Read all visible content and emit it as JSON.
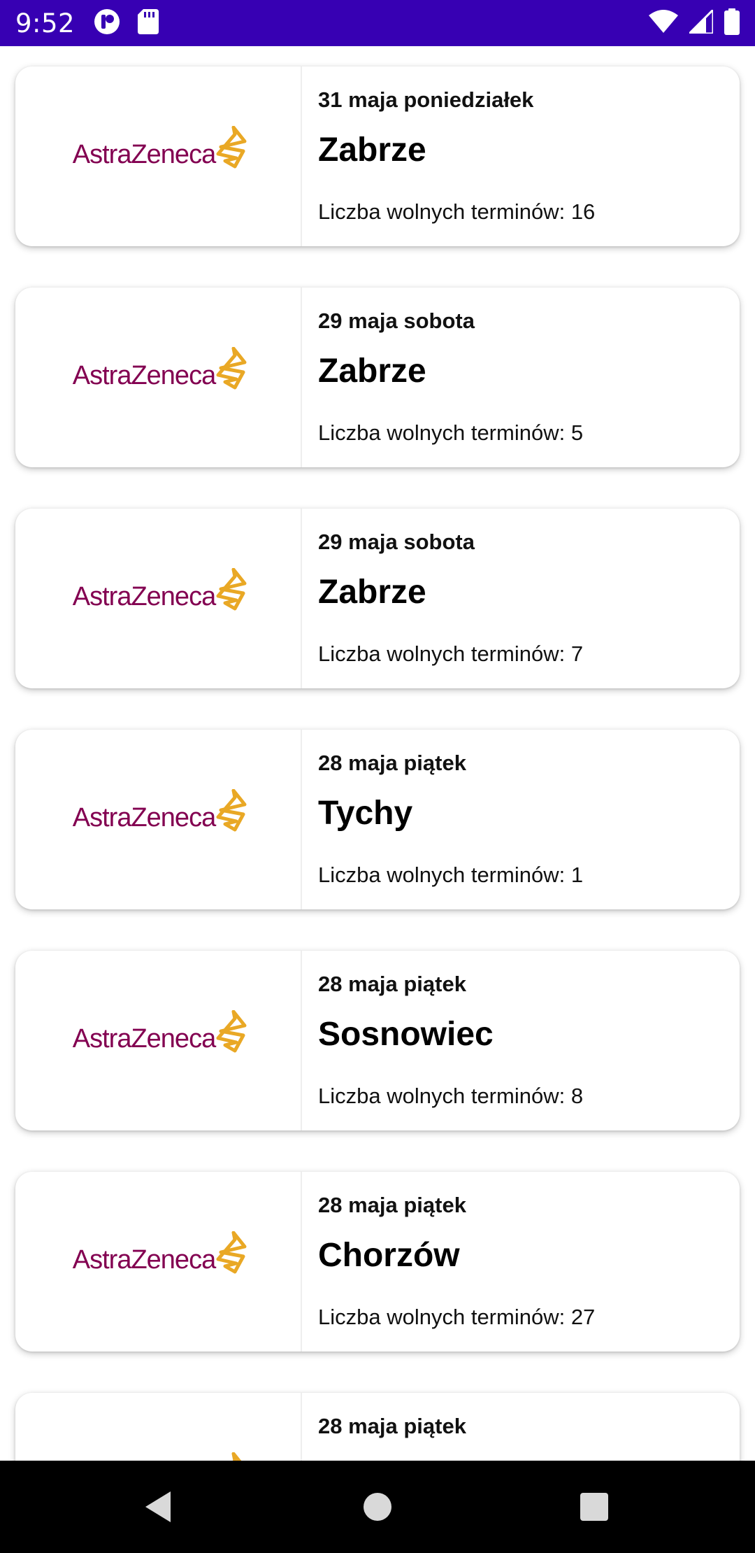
{
  "status_bar": {
    "time": "9:52",
    "background_color": "#3700b3",
    "left_icons": [
      "app-notification-icon",
      "sd-card-icon"
    ],
    "right_icons": [
      "wifi-icon",
      "cell-signal-icon",
      "battery-icon"
    ]
  },
  "logo": {
    "text": "AstraZeneca",
    "text_color": "#830051",
    "mark_color": "#e9a825"
  },
  "items": [
    {
      "date": "31 maja poniedziałek",
      "city": "Zabrze",
      "slots": "Liczba wolnych terminów: 16"
    },
    {
      "date": "29 maja sobota",
      "city": "Zabrze",
      "slots": "Liczba wolnych terminów: 5"
    },
    {
      "date": "29 maja sobota",
      "city": "Zabrze",
      "slots": "Liczba wolnych terminów: 7"
    },
    {
      "date": "28 maja piątek",
      "city": "Tychy",
      "slots": "Liczba wolnych terminów: 1"
    },
    {
      "date": "28 maja piątek",
      "city": "Sosnowiec",
      "slots": "Liczba wolnych terminów: 8"
    },
    {
      "date": "28 maja piątek",
      "city": "Chorzów",
      "slots": "Liczba wolnych terminów: 27"
    },
    {
      "date": "28 maja piątek"
    }
  ],
  "nav_bar": {
    "buttons": [
      "back-icon",
      "home-icon",
      "recents-icon"
    ]
  }
}
